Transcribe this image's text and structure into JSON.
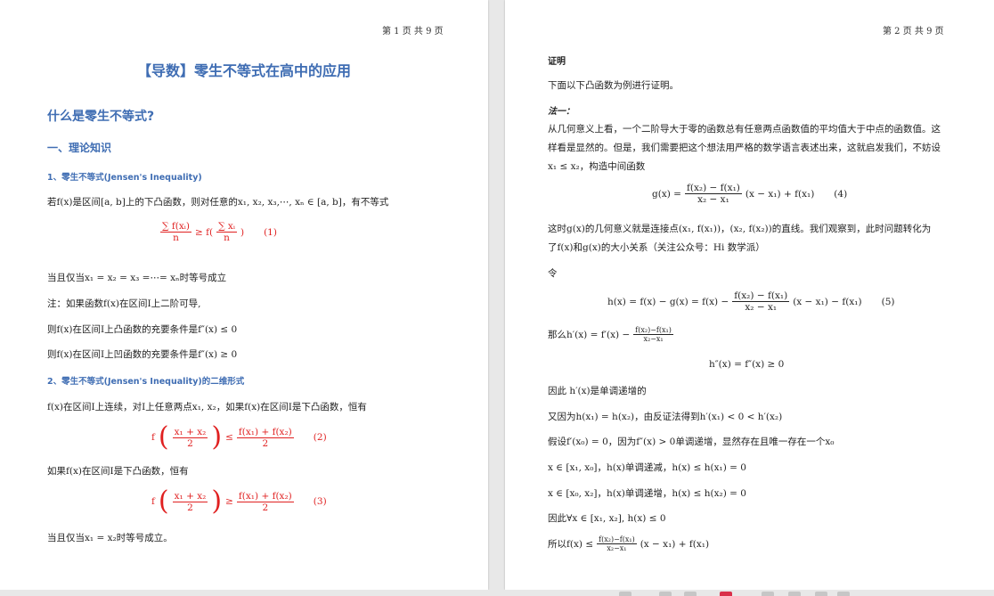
{
  "page1": {
    "page_num": "第 1 页 共 9 页",
    "title": "【导数】零生不等式在高中的应用",
    "heading_main": "什么是零生不等式?",
    "heading_theory": "一、理论知识",
    "heading_1": "1、零生不等式(Jensen's Inequality)",
    "line_if": "若f(x)是区间[a, b]上的下凸函数，则对任意的x₁, x₂, x₃,⋯, xₙ ∈ [a, b]，有不等式",
    "f1_num_sum": "∑ f(xᵢ)",
    "f1_sum_idx": "i=1",
    "f1_sum_top": "n",
    "f1_den": "n",
    "f1_geq": "≥ f(",
    "f1_inner": "∑ xᵢ",
    "f1_close": ")",
    "f1_tag": "(1)",
    "line_eq_when": "当且仅当x₁ = x₂ = x₃ =⋯= xₙ时等号成立",
    "note_1": "注：如果函数f(x)在区间I上二阶可导,",
    "note_2": "则f(x)在区间I上凸函数的充要条件是f″(x) ≤ 0",
    "note_3": "则f(x)在区间I上凹函数的充要条件是f″(x) ≥ 0",
    "heading_2": "2、零生不等式(Jensen's Inequality)的二维形式",
    "line_cont": "f(x)在区间I上连续，对I上任意两点x₁, x₂，如果f(x)在区间I是下凸函数，恒有",
    "f2_left_num": "x₁ + x₂",
    "f2_left_den": "2",
    "f2_rel": "≤",
    "f2_right_num": "f(x₁) + f(x₂)",
    "f2_right_den": "2",
    "f2_tag": "(2)",
    "line_lower": "如果f(x)在区间I是下凸函数，恒有",
    "f3_rel": "≥",
    "f3_tag": "(3)",
    "line_end": "当且仅当x₁ = x₂时等号成立。"
  },
  "page2": {
    "page_num": "第 2 页 共 9 页",
    "proof": "证明",
    "intro": "下面以下凸函数为例进行证明。",
    "method": "法一：",
    "p1": "从几何意义上看，一个二阶导大于零的函数总有任意两点函数值的平均值大于中点的函数值。这",
    "p2": "样看是显然的。但是，我们需要把这个想法用严格的数学语言表述出来，这就启发我们，不妨设",
    "p3": "x₁ ≤ x₂，构造中间函数",
    "f4_lhs": "g(x) =",
    "f4_num": "f(x₂) − f(x₁)",
    "f4_den": "x₂ − x₁",
    "f4_rhs": "(x − x₁) + f(x₁)",
    "f4_tag": "(4)",
    "p4": "这时g(x)的几何意义就是连接点(x₁, f(x₁))，(x₂, f(x₂))的直线。我们观察到，此时问题转化为",
    "p5": "了f(x)和g(x)的大小关系（关注公众号：Hi 数学派）",
    "p6": "令",
    "f5_lhs": "h(x) = f(x) − g(x) = f(x) −",
    "f5_num": "f(x₂) − f(x₁)",
    "f5_den": "x₂ − x₁",
    "f5_rhs": "(x − x₁) − f(x₁)",
    "f5_tag": "(5)",
    "p7_lhs": "那么h′(x) = f′(x) −",
    "p7_num": "f(x₂)−f(x₁)",
    "p7_den": "x₂−x₁",
    "p8": "h″(x) = f″(x) ≥ 0",
    "p9": "因此 h′(x)是单调递增的",
    "p10": "又因为h(x₁) = h(x₂)，由反证法得到h′(x₁) < 0 < h′(x₂)",
    "p11": "假设f′(x₀) = 0，因为f″(x) > 0单调递增，显然存在且唯一存在一个x₀",
    "p12": "x ∈ [x₁, x₀]，h(x)单调递减，h(x) ≤ h(x₁) = 0",
    "p13": "x ∈ [x₀, x₂]，h(x)单调递增，h(x) ≤ h(x₂) = 0",
    "p14": "因此∀x ∈ [x₁, x₂], h(x) ≤ 0",
    "p15_lhs": "所以f(x) ≤",
    "p15_num": "f(x₂)−f(x₁)",
    "p15_den": "x₂−x₁",
    "p15_rhs": "(x − x₁) + f(x₁)"
  },
  "colors": {
    "heading": "#3f6db3",
    "formula": "#e02020"
  }
}
